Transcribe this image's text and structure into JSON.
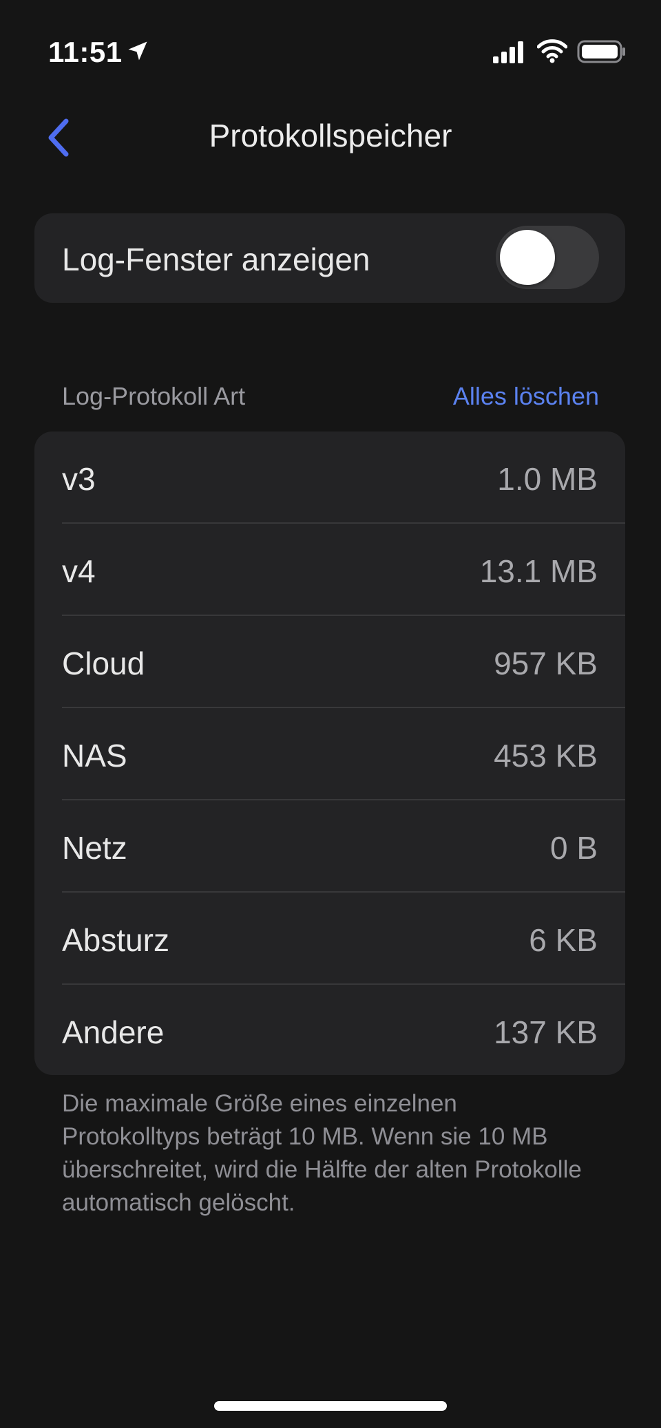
{
  "status_bar": {
    "time": "11:51",
    "icons": [
      "location-arrow-icon",
      "cellular-signal-icon",
      "wifi-icon",
      "battery-icon"
    ]
  },
  "nav": {
    "title": "Protokollspeicher",
    "back_icon": "chevron-left-icon",
    "accent_color": "#4f6df0"
  },
  "toggle": {
    "label": "Log-Fenster anzeigen",
    "enabled": false
  },
  "section": {
    "header": "Log-Protokoll Art",
    "action_label": "Alles löschen",
    "action_color": "#5b82f0"
  },
  "log_types": [
    {
      "label": "v3",
      "size": "1.0 MB"
    },
    {
      "label": "v4",
      "size": "13.1 MB"
    },
    {
      "label": "Cloud",
      "size": "957 KB"
    },
    {
      "label": "NAS",
      "size": "453 KB"
    },
    {
      "label": "Netz",
      "size": "0 B"
    },
    {
      "label": "Absturz",
      "size": "6 KB"
    },
    {
      "label": "Andere",
      "size": "137 KB"
    }
  ],
  "footnote": "Die maximale Größe eines einzelnen Protokolltyps beträgt 10 MB. Wenn sie 10 MB überschreitet, wird die Hälfte der alten Protokolle automatisch gelöscht."
}
